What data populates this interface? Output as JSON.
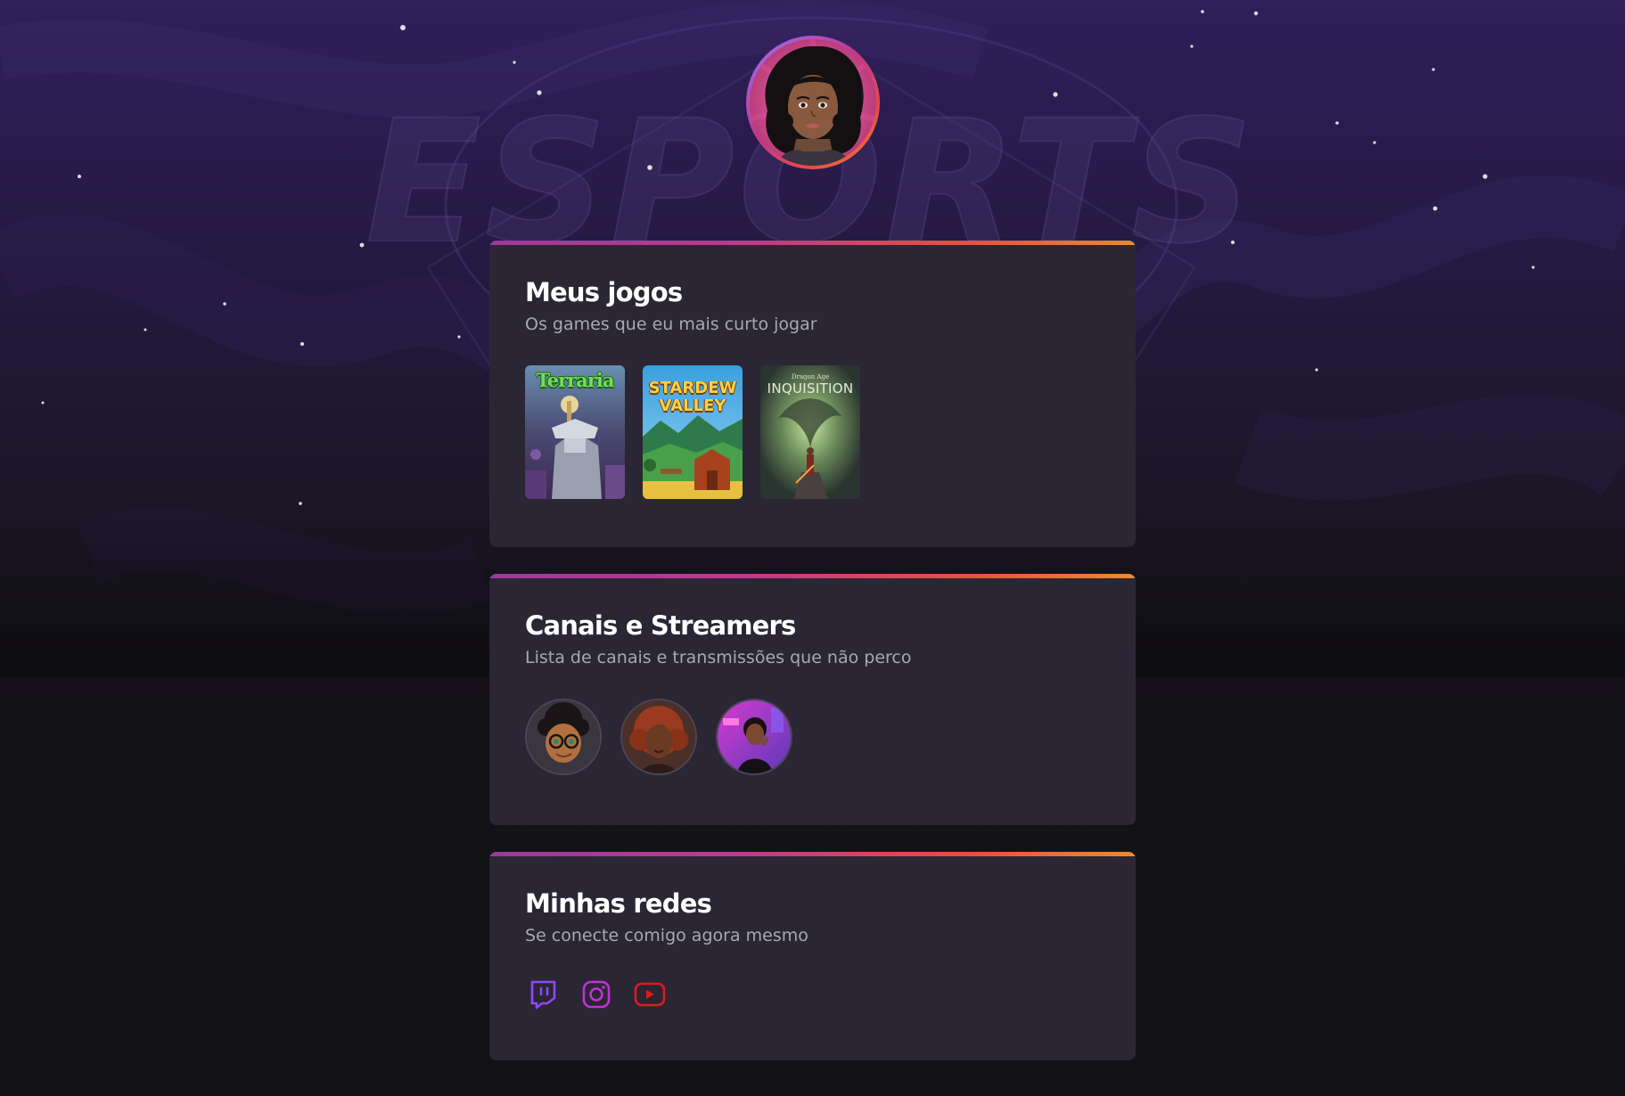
{
  "background": {
    "watermark": "ESPORTS"
  },
  "profile": {
    "avatar_icon": "female-gamer-avatar"
  },
  "sections": {
    "games": {
      "title": "Meus jogos",
      "subtitle": "Os games que eu mais curto jogar",
      "items": [
        {
          "title": "Terraria"
        },
        {
          "title": "STARDEW\nVALLEY"
        },
        {
          "pre": "Dragon Age",
          "title": "INQUISITION"
        }
      ]
    },
    "streamers": {
      "title": "Canais e Streamers",
      "subtitle": "Lista de canais e transmissões que não perco",
      "items": [
        {
          "icon": "cartoon-streamer-avatar"
        },
        {
          "icon": "streamer-photo-avatar"
        },
        {
          "icon": "streamer-neon-avatar"
        }
      ]
    },
    "socials": {
      "title": "Minhas redes",
      "subtitle": "Se conecte comigo agora mesmo",
      "items": [
        {
          "icon": "twitch-icon",
          "color": "#9146ff"
        },
        {
          "icon": "instagram-icon",
          "color": "#c231d8"
        },
        {
          "icon": "youtube-icon",
          "color": "#e01b1b"
        }
      ]
    }
  },
  "colors": {
    "card_bg": "#2a2634",
    "accent_gradient": [
      "#9a3a9e",
      "#c2378c",
      "#e8503d",
      "#f08a2a"
    ],
    "text_muted": "#a8a8b3"
  }
}
